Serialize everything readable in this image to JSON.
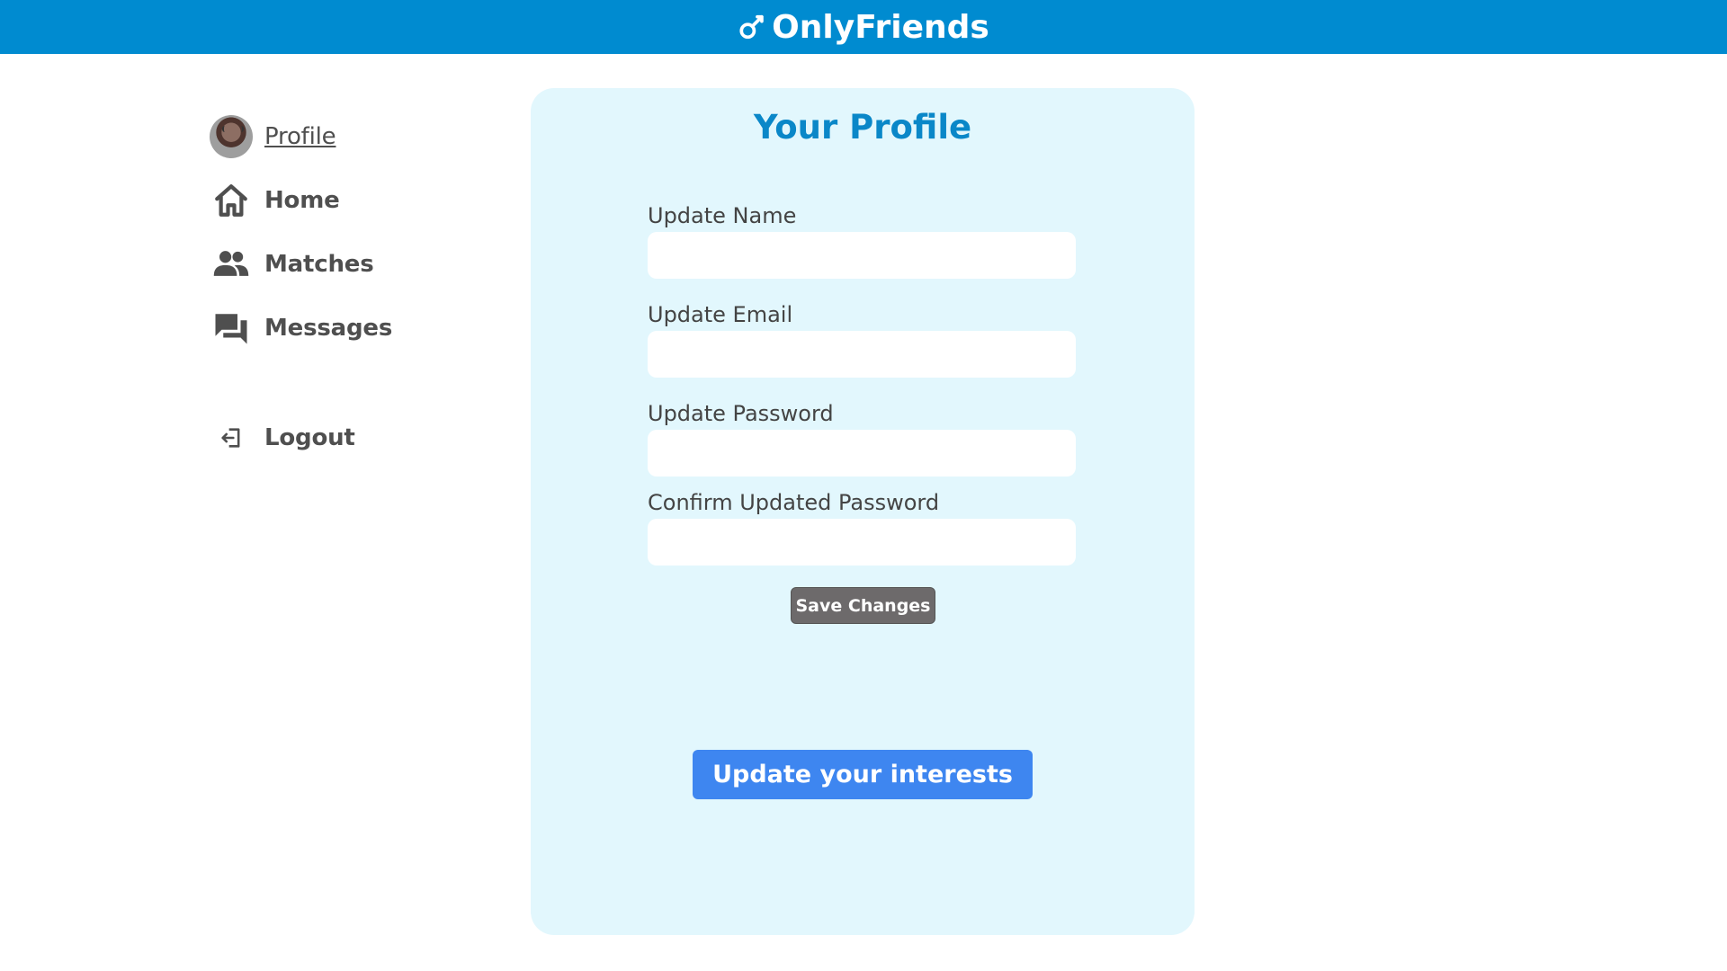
{
  "header": {
    "brand": "OnlyFriends",
    "brand_icon": "key-icon",
    "background": "#008bd0"
  },
  "sidebar": {
    "items": [
      {
        "label": "Profile",
        "icon": "avatar"
      },
      {
        "label": "Home",
        "icon": "home-icon"
      },
      {
        "label": "Matches",
        "icon": "people-icon"
      },
      {
        "label": "Messages",
        "icon": "chat-icon"
      }
    ],
    "logout": {
      "label": "Logout",
      "icon": "logout-icon"
    }
  },
  "profile_form": {
    "title": "Your Profile",
    "fields": [
      {
        "label": "Update Name",
        "value": "",
        "placeholder": ""
      },
      {
        "label": "Update Email",
        "value": "",
        "placeholder": ""
      },
      {
        "label": "Update Password",
        "value": "",
        "placeholder": ""
      },
      {
        "label": "Confirm Updated Password",
        "value": "",
        "placeholder": ""
      }
    ],
    "save_label": "Save Changes",
    "interests_label": "Update your interests",
    "card_color": "#e2f7fd",
    "title_color": "#0a87c8",
    "interests_button_color": "#3e86f0",
    "save_button_color": "#6d6a6b"
  }
}
